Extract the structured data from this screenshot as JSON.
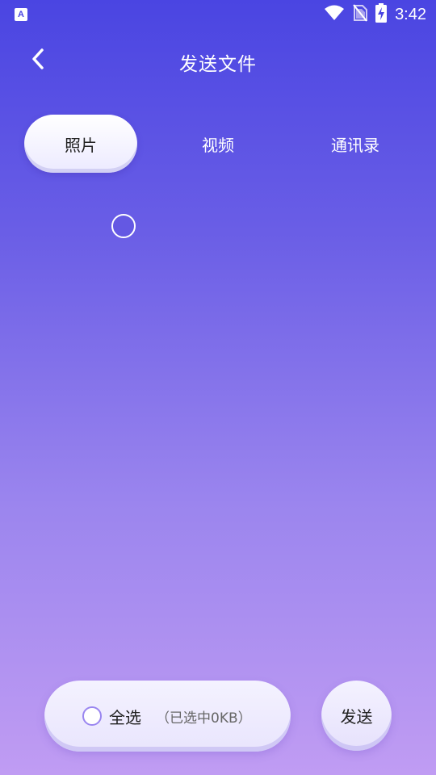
{
  "status_bar": {
    "app_icon_letter": "A",
    "time": "3:42",
    "icons": [
      "wifi-icon",
      "no-sim-icon",
      "battery-charging-icon"
    ]
  },
  "header": {
    "title": "发送文件",
    "back_icon": "chevron-left-icon"
  },
  "tabs": [
    {
      "label": "照片",
      "active": true
    },
    {
      "label": "视频",
      "active": false
    },
    {
      "label": "通讯录",
      "active": false
    }
  ],
  "bottom": {
    "select_all_label": "全选",
    "selected_size": "（已选中0KB）",
    "send_label": "发送"
  },
  "colors": {
    "gradient_top": "#4a45e2",
    "gradient_bottom": "#c09cf3",
    "pill_bg": "#f4f2ff",
    "radio_border": "#9a86f0"
  }
}
